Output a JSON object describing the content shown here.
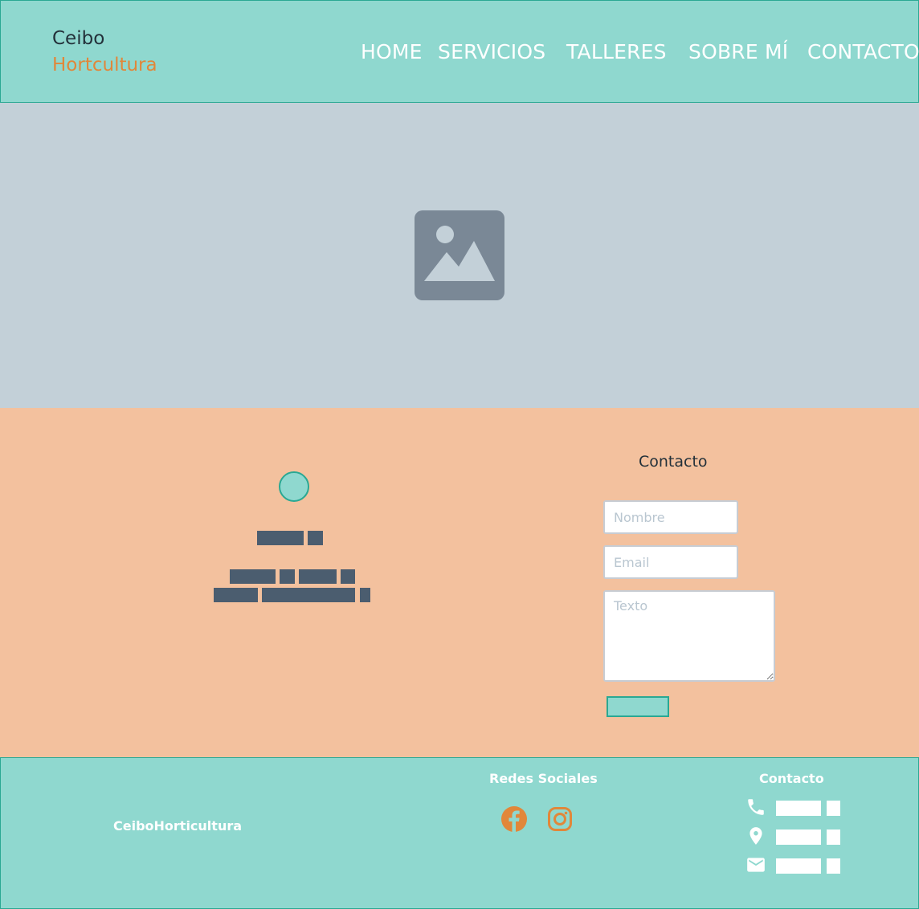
{
  "header": {
    "brand_top": "Ceibo",
    "brand_bottom": "Hortcultura",
    "nav": [
      "HOME",
      "SERVICIOS",
      "TALLERES",
      "SOBRE MÍ",
      "CONTACTO"
    ]
  },
  "hero": {
    "icon": "image-placeholder-icon"
  },
  "contact": {
    "title": "Contacto",
    "name_placeholder": "Nombre",
    "email_placeholder": "Email",
    "text_placeholder": "Texto"
  },
  "footer": {
    "brand": "CeiboHorticultura",
    "social_title": "Redes Sociales",
    "social_icons": [
      "facebook-icon",
      "instagram-icon"
    ],
    "contact_title": "Contacto",
    "contact_icons": [
      "phone-icon",
      "location-pin-icon",
      "mail-icon"
    ]
  },
  "colors": {
    "header_bg": "#8fd8cf",
    "accent_orange": "#e1873a",
    "hero_bg": "#c3d0d8",
    "contact_bg": "#f3c19e",
    "placeholder_block": "#4b5d6f"
  }
}
